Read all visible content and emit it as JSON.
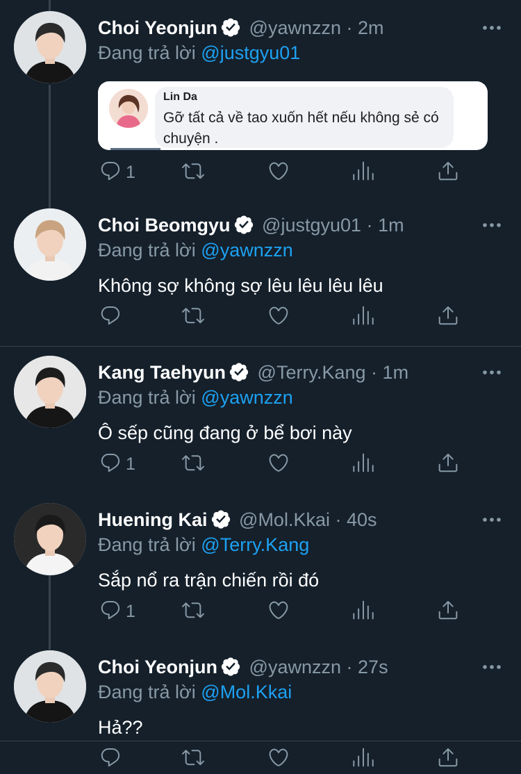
{
  "reply_prefix": "Đang trả lời",
  "tweets": [
    {
      "name": "Choi Yeonjun",
      "handle": "@yawnzzn",
      "dot": "·",
      "time": "2m",
      "reply_to": "@justgyu01",
      "text": "",
      "reply_count": "1",
      "quote": {
        "name": "Lin Da",
        "text": "Gỡ tất cả về tao xuốn hết nếu không sẻ có chuyện ."
      }
    },
    {
      "name": "Choi Beomgyu",
      "handle": "@justgyu01",
      "dot": "·",
      "time": "1m",
      "reply_to": "@yawnzzn",
      "text": "Không sợ không sợ lêu lêu lêu lêu",
      "reply_count": ""
    },
    {
      "name": "Kang Taehyun",
      "handle": "@Terry.Kang",
      "dot": "·",
      "time": "1m",
      "reply_to": "@yawnzzn",
      "text": "Ô sếp cũng đang ở bể bơi này",
      "reply_count": "1"
    },
    {
      "name": "Huening Kai",
      "handle": "@Mol.Kkai",
      "dot": "·",
      "time": "40s",
      "reply_to": "@Terry.Kang",
      "text": "Sắp nổ ra trận chiến rồi đó",
      "reply_count": "1"
    },
    {
      "name": "Choi Yeonjun",
      "handle": "@yawnzzn",
      "dot": "·",
      "time": "27s",
      "reply_to": "@Mol.Kkai",
      "text": "Hả??",
      "reply_count": ""
    }
  ],
  "icons": {
    "reply": "reply-icon",
    "retweet": "retweet-icon",
    "like": "heart-icon",
    "analytics": "analytics-icon",
    "share": "share-icon",
    "more": "more-icon",
    "verified": "verified-badge-icon"
  },
  "colors": {
    "background": "#15202b",
    "secondary_text": "#8899a6",
    "mention": "#1da1f2",
    "divider": "#38444d"
  }
}
